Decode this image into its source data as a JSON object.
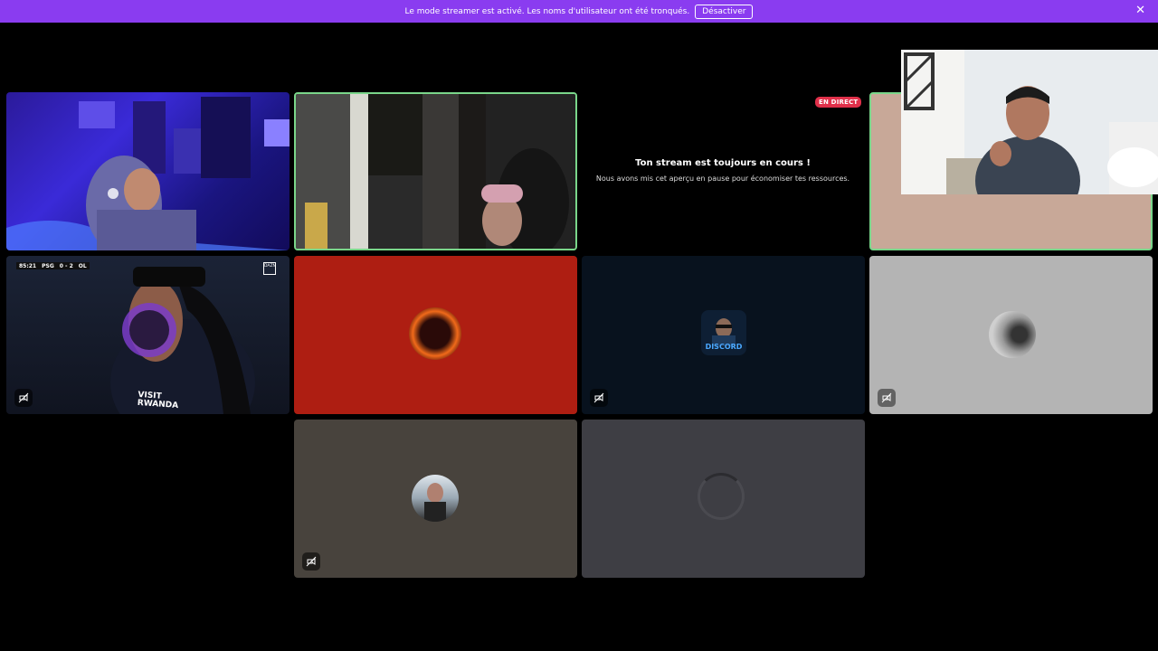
{
  "banner": {
    "message": "Le mode streamer est activé. Les noms d'utilisateur ont été tronqués.",
    "button_label": "Désactiver",
    "close_icon": "close-icon"
  },
  "colors": {
    "banner": "#8a3cf0",
    "speaking_border": "#7ad68a",
    "live": "#e0304a",
    "tile_red": "#ae1e12",
    "tile_navy": "#08121e",
    "tile_gray": "#b4b4b4",
    "tile_taupe": "#48433d",
    "tile_slate": "#3e3e44"
  },
  "stream": {
    "live_badge": "EN DIRECT",
    "paused_title": "Ton stream est toujours en cours !",
    "paused_subtitle": "Nous avons mis cet aperçu en pause pour économiser tes ressources."
  },
  "scoreboard": {
    "time": "85:21",
    "home": "PSG",
    "score": "0 - 2",
    "away": "OL",
    "broadcaster": "DAZN"
  },
  "shirt_text": "VISIT\nRWANDA",
  "discord_label": "DISCORD",
  "icons": {
    "muted": "video-off-icon",
    "loading": "loading-spinner-icon"
  }
}
